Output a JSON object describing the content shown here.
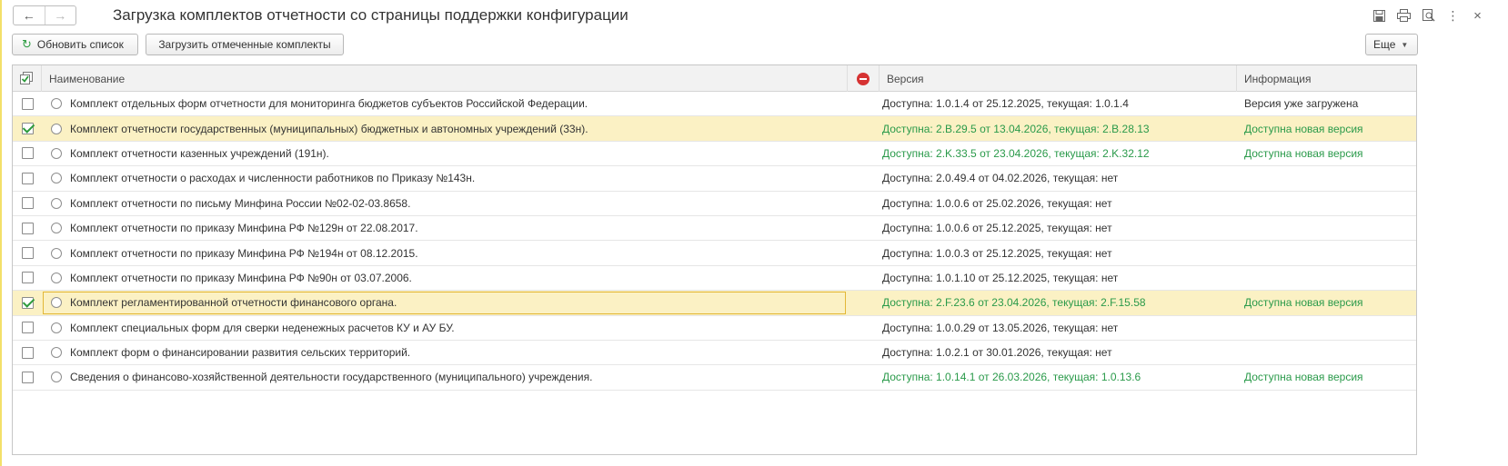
{
  "window": {
    "title": "Загрузка комплектов отчетности со страницы поддержки конфигурации"
  },
  "toolbar": {
    "refresh_label": "Обновить список",
    "load_label": "Загрузить отмеченные комплекты",
    "more_label": "Еще"
  },
  "icons": {
    "back": "arrow-left-icon",
    "forward": "arrow-right-icon",
    "save": "save-icon",
    "print": "print-icon",
    "preview": "preview-icon",
    "menu": "more-vertical-icon",
    "close": "close-icon",
    "refresh": "refresh-icon",
    "header_flag": "stop-icon"
  },
  "colors": {
    "accent_green": "#2a9a4a",
    "selected_row": "#fbf1c4",
    "focus_border": "#e2b737"
  },
  "table": {
    "columns": {
      "name": "Наименование",
      "version": "Версия",
      "info": "Информация"
    },
    "rows": [
      {
        "checked": false,
        "name": "Комплект отдельных форм отчетности для мониторинга бюджетов субъектов Российской Федерации.",
        "version": "Доступна: 1.0.1.4 от 25.12.2025, текущая: 1.0.1.4",
        "info": "Версия уже загружена"
      },
      {
        "checked": true,
        "name": "Комплект отчетности государственных (муниципальных) бюджетных и автономных учреждений (33н).",
        "version": "Доступна: 2.B.29.5 от 13.04.2026, текущая: 2.B.28.13",
        "info": "Доступна новая версия"
      },
      {
        "checked": false,
        "name": "Комплект отчетности казенных учреждений (191н).",
        "version": "Доступна: 2.K.33.5 от 23.04.2026, текущая: 2.K.32.12",
        "info": "Доступна новая версия"
      },
      {
        "checked": false,
        "name": "Комплект отчетности о расходах и численности работников по Приказу №143н.",
        "version": "Доступна: 2.0.49.4 от 04.02.2026, текущая: нет",
        "info": ""
      },
      {
        "checked": false,
        "name": "Комплект отчетности по письму Минфина России №02-02-03.8658.",
        "version": "Доступна: 1.0.0.6 от 25.02.2026, текущая: нет",
        "info": ""
      },
      {
        "checked": false,
        "name": "Комплект отчетности по приказу Минфина РФ №129н от 22.08.2017.",
        "version": "Доступна: 1.0.0.6 от 25.12.2025, текущая: нет",
        "info": ""
      },
      {
        "checked": false,
        "name": "Комплект отчетности по приказу Минфина РФ №194н от 08.12.2015.",
        "version": "Доступна: 1.0.0.3 от 25.12.2025, текущая: нет",
        "info": ""
      },
      {
        "checked": false,
        "name": "Комплект отчетности по приказу Минфина РФ №90н от 03.07.2006.",
        "version": "Доступна: 1.0.1.10 от 25.12.2025, текущая: нет",
        "info": ""
      },
      {
        "checked": true,
        "name": "Комплект регламентированной отчетности финансового органа.",
        "version": "Доступна: 2.F.23.6 от 23.04.2026, текущая: 2.F.15.58",
        "info": "Доступна новая версия"
      },
      {
        "checked": false,
        "name": "Комплект специальных форм для сверки неденежных расчетов КУ и АУ БУ.",
        "version": "Доступна: 1.0.0.29 от 13.05.2026, текущая: нет",
        "info": ""
      },
      {
        "checked": false,
        "name": "Комплект форм о финансировании развития сельских территорий.",
        "version": "Доступна: 1.0.2.1 от 30.01.2026, текущая: нет",
        "info": ""
      },
      {
        "checked": false,
        "name": "Сведения о финансово-хозяйственной деятельности государственного (муниципального) учреждения.",
        "version": "Доступна: 1.0.14.1 от 26.03.2026, текущая: 1.0.13.6",
        "info": "Доступна новая версия"
      }
    ]
  }
}
